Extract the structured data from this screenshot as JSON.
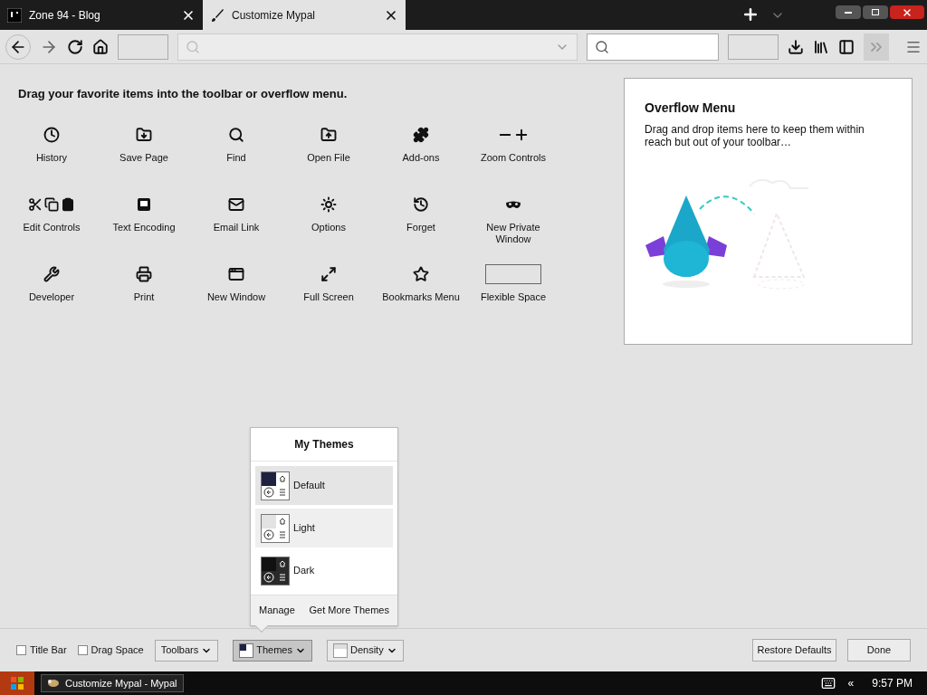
{
  "tabs": [
    {
      "title": "Zone 94 - Blog",
      "selected": false
    },
    {
      "title": "Customize Mypal",
      "selected": true
    }
  ],
  "instruction": "Drag your favorite items into the toolbar or overflow menu.",
  "palette": [
    {
      "label": "History",
      "kind": "clock"
    },
    {
      "label": "Save Page",
      "kind": "save"
    },
    {
      "label": "Find",
      "kind": "search"
    },
    {
      "label": "Open File",
      "kind": "open"
    },
    {
      "label": "Add-ons",
      "kind": "puzzle"
    },
    {
      "label": "Zoom Controls",
      "kind": "zoom"
    },
    {
      "label": "Edit Controls",
      "kind": "edit"
    },
    {
      "label": "Text Encoding",
      "kind": "encoding"
    },
    {
      "label": "Email Link",
      "kind": "mail"
    },
    {
      "label": "Options",
      "kind": "gear"
    },
    {
      "label": "Forget",
      "kind": "forget"
    },
    {
      "label": "New Private Window",
      "kind": "mask"
    },
    {
      "label": "Developer",
      "kind": "wrench"
    },
    {
      "label": "Print",
      "kind": "print"
    },
    {
      "label": "New Window",
      "kind": "window"
    },
    {
      "label": "Full Screen",
      "kind": "fullscreen"
    },
    {
      "label": "Bookmarks Menu",
      "kind": "star"
    },
    {
      "label": "Flexible Space",
      "kind": "spacer"
    }
  ],
  "overflow_panel": {
    "title": "Overflow Menu",
    "text": "Drag and drop items here to keep them within reach but out of your toolbar…"
  },
  "themes_popup": {
    "title": "My Themes",
    "themes": [
      {
        "name": "Default",
        "kind": "default",
        "selected": true,
        "hovered": false
      },
      {
        "name": "Light",
        "kind": "light",
        "selected": false,
        "hovered": true
      },
      {
        "name": "Dark",
        "kind": "dark",
        "selected": false,
        "hovered": false
      }
    ],
    "links": [
      "Manage",
      "Get More Themes"
    ]
  },
  "footer": {
    "checkboxes": [
      {
        "label": "Title Bar",
        "checked": false
      },
      {
        "label": "Drag Space",
        "checked": false
      }
    ],
    "menus": [
      {
        "label": "Toolbars",
        "kind": "plain",
        "open": false
      },
      {
        "label": "Themes",
        "kind": "themes",
        "open": true
      },
      {
        "label": "Density",
        "kind": "density",
        "open": false
      }
    ],
    "buttons": [
      "Restore Defaults",
      "Done"
    ]
  },
  "taskbar": {
    "task": "Customize Mypal - Mypal",
    "tray_toggle": "«",
    "clock": "9:57 PM"
  }
}
